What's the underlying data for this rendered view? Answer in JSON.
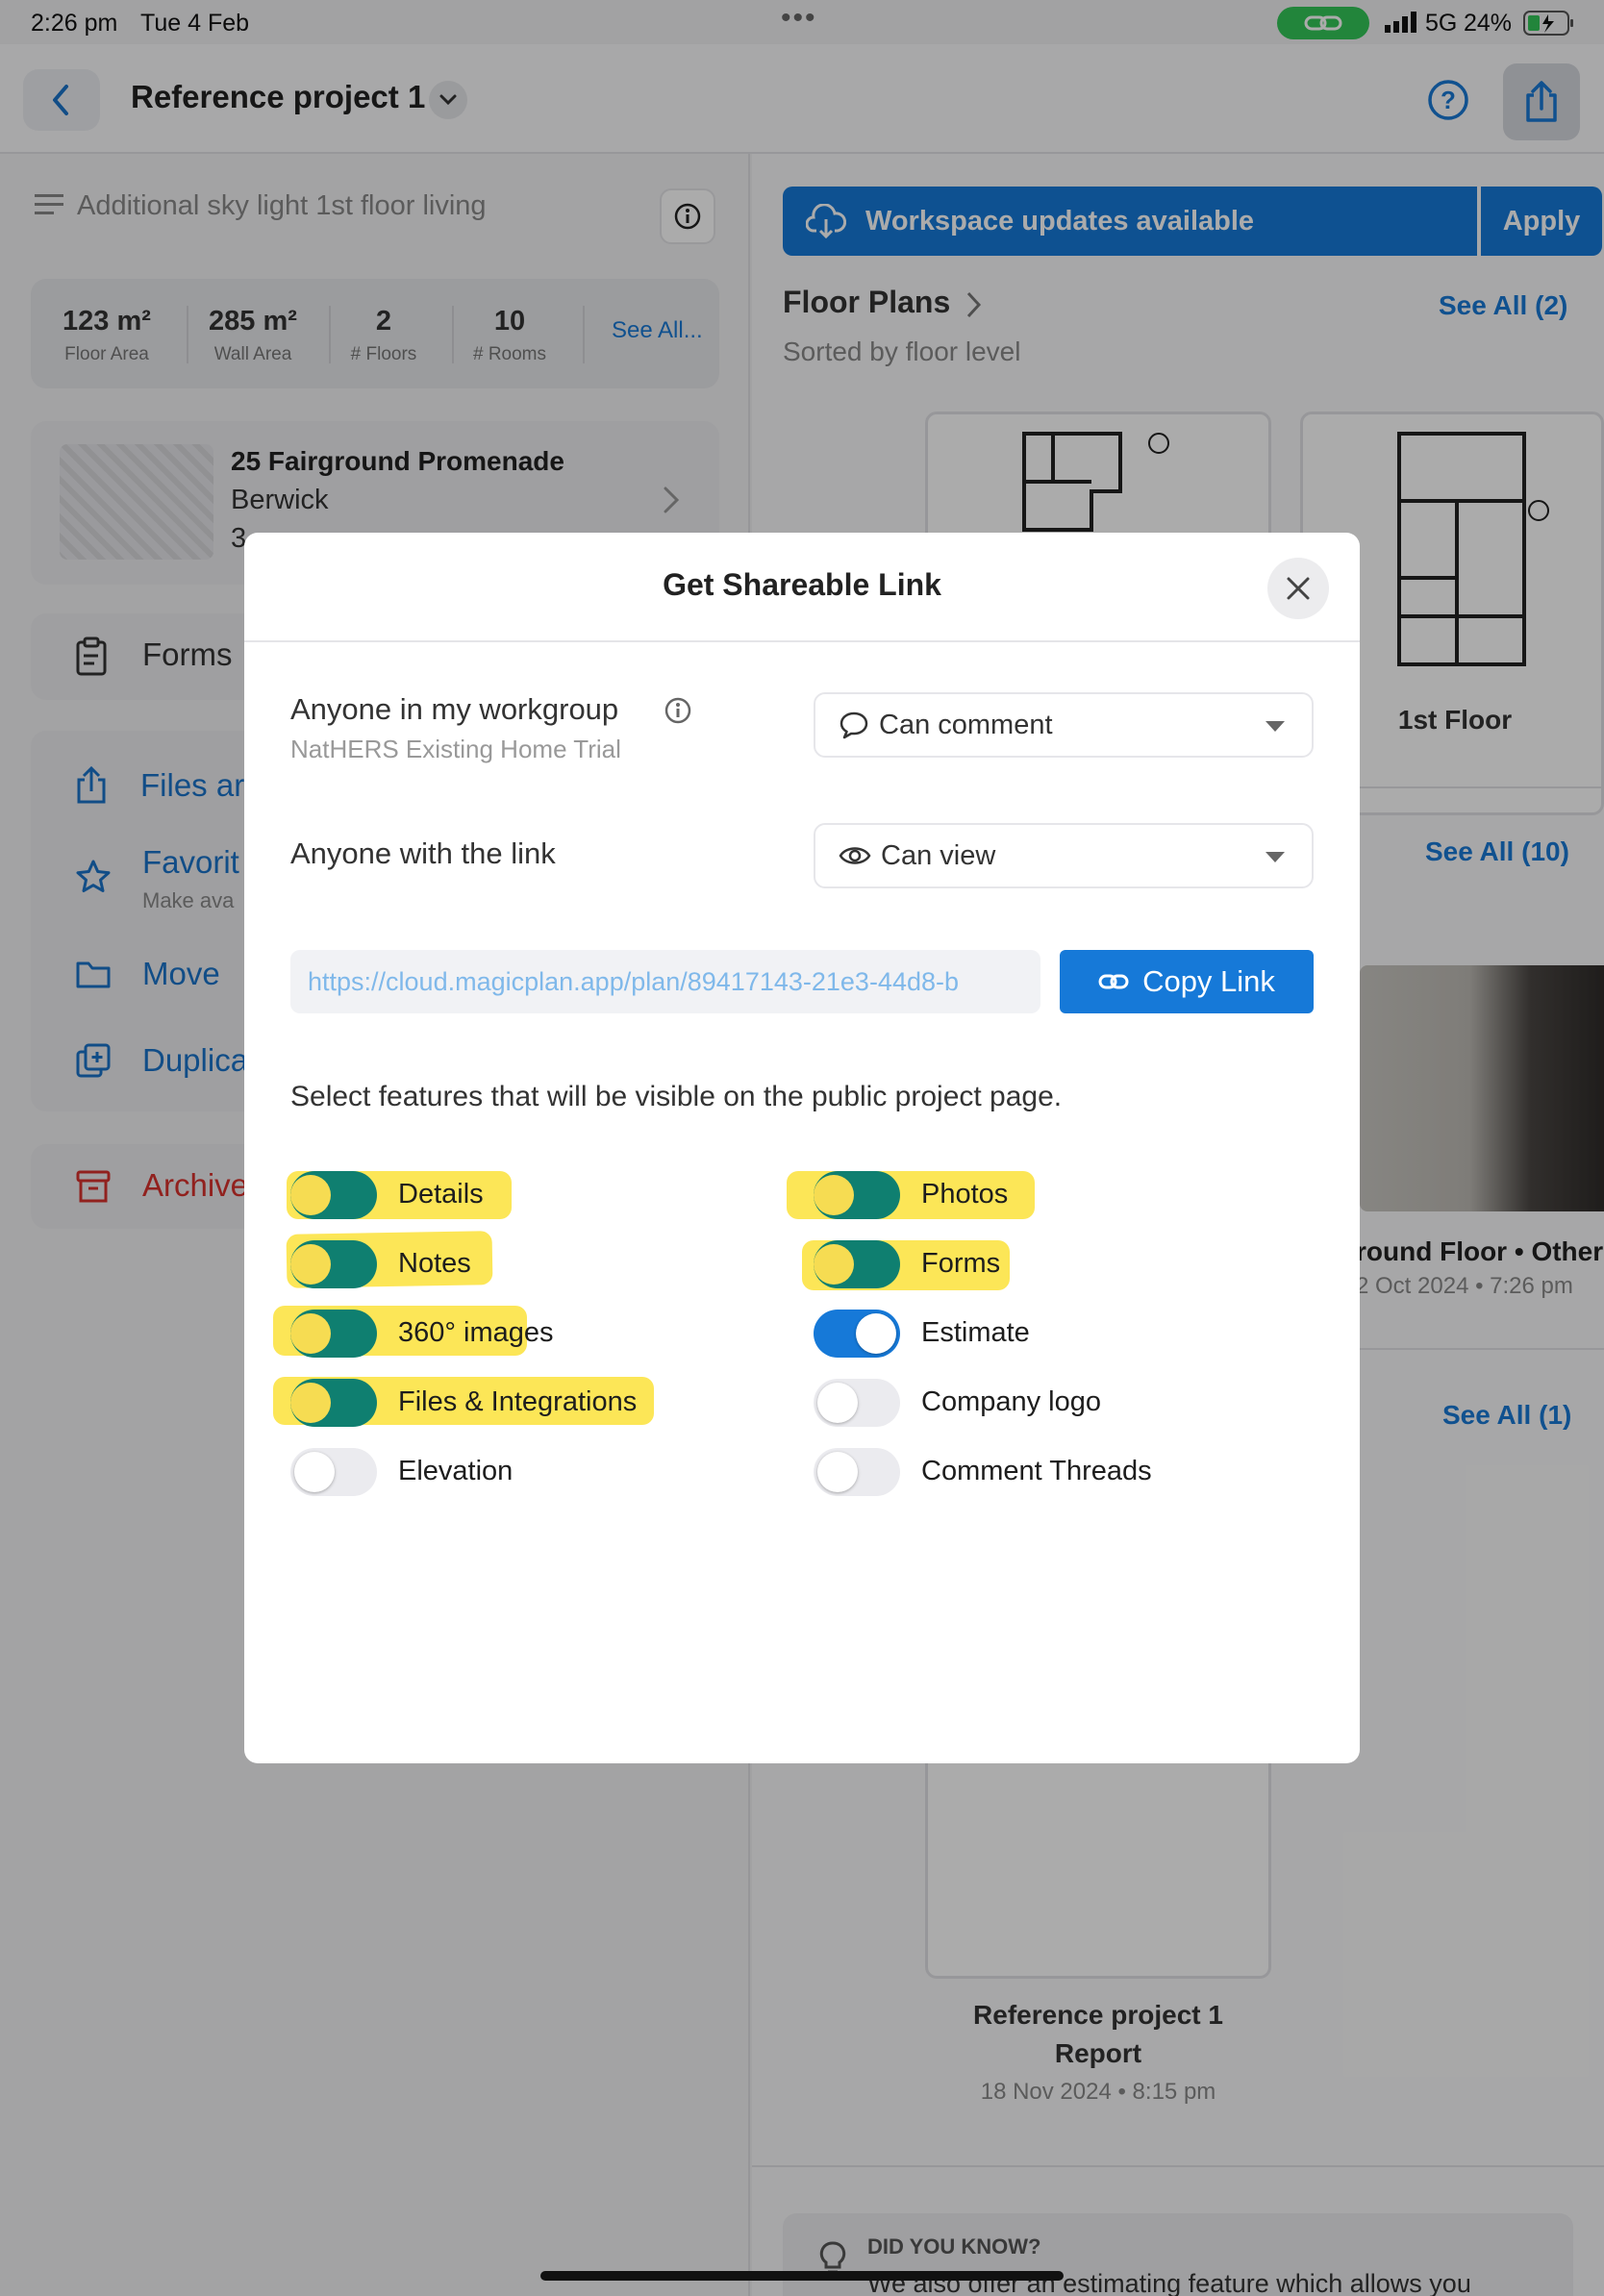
{
  "status_bar": {
    "time": "2:26 pm",
    "date": "Tue 4 Feb",
    "network": "5G",
    "battery": "24%"
  },
  "header": {
    "title": "Reference project 1"
  },
  "left": {
    "description": "Additional sky light 1st floor living",
    "stats": [
      {
        "value": "123 m²",
        "label": "Floor Area"
      },
      {
        "value": "285 m²",
        "label": "Wall Area"
      },
      {
        "value": "2",
        "label": "# Floors"
      },
      {
        "value": "10",
        "label": "# Rooms"
      }
    ],
    "stats_see_all": "See All...",
    "address": {
      "line1": "25 Fairground Promenade",
      "line2": "Berwick",
      "line3": "3"
    },
    "forms_label": "Forms",
    "files_label": "Files ar",
    "favorite_label": "Favorit",
    "favorite_sub": "Make ava",
    "move_label": "Move",
    "duplicate_label": "Duplica",
    "archive_label": "Archive"
  },
  "right": {
    "updates_banner": "Workspace updates available",
    "apply": "Apply",
    "floor_plans_title": "Floor Plans",
    "floor_plans_sub": "Sorted by floor level",
    "floor_plans_see_all": "See All (2)",
    "floor_label_2": "1st Floor",
    "photos_see_all": "See All (10)",
    "photo_caption": "round Floor • Other",
    "photo_date": "2 Oct 2024 • 7:26 pm",
    "reports_see_all": "See All (1)",
    "report_title_1": "Reference project 1",
    "report_title_2": "Report",
    "report_date": "18 Nov 2024 • 8:15 pm",
    "tip_heading": "DID YOU KNOW?",
    "tip_text": "We also offer an estimating feature which allows you"
  },
  "modal": {
    "title": "Get Shareable Link",
    "workgroup_label": "Anyone in my workgroup",
    "workgroup_sub": "NatHERS Existing Home Trial",
    "workgroup_permission": "Can comment",
    "link_label": "Anyone with the link",
    "link_permission": "Can view",
    "url": "https://cloud.magicplan.app/plan/89417143-21e3-44d8-b",
    "copy_button": "Copy Link",
    "features_intro": "Select features that will be visible on the public project page.",
    "features_left": [
      {
        "label": "Details",
        "on": true
      },
      {
        "label": "Notes",
        "on": true
      },
      {
        "label": "360° images",
        "on": true
      },
      {
        "label": "Files & Integrations",
        "on": true
      },
      {
        "label": "Elevation",
        "on": false
      }
    ],
    "features_right": [
      {
        "label": "Photos",
        "on": true
      },
      {
        "label": "Forms",
        "on": true
      },
      {
        "label": "Estimate",
        "on": true
      },
      {
        "label": "Company logo",
        "on": false
      },
      {
        "label": "Comment Threads",
        "on": false
      }
    ]
  },
  "colors": {
    "accent": "#1679d8",
    "danger": "#d9322e",
    "highlight": "#fce23a"
  }
}
